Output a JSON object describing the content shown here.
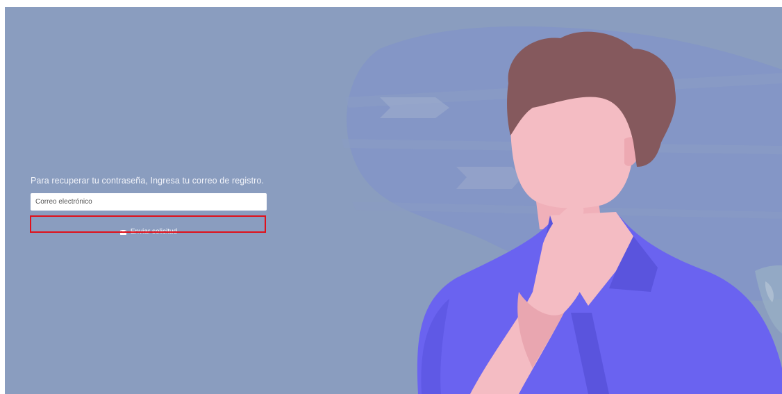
{
  "recovery_form": {
    "instruction": "Para recuperar tu contraseña, Ingresa tu correo de registro.",
    "email_placeholder": "Correo electrónico",
    "email_value": "",
    "submit_label": "Enviar solicitud",
    "submit_icon": "envelope-icon"
  },
  "colors": {
    "background": "#8a9dbf",
    "highlight": "#e0101a",
    "shirt": "#6a63f0",
    "skin": "#f4bcc3",
    "hair": "#85595d"
  }
}
